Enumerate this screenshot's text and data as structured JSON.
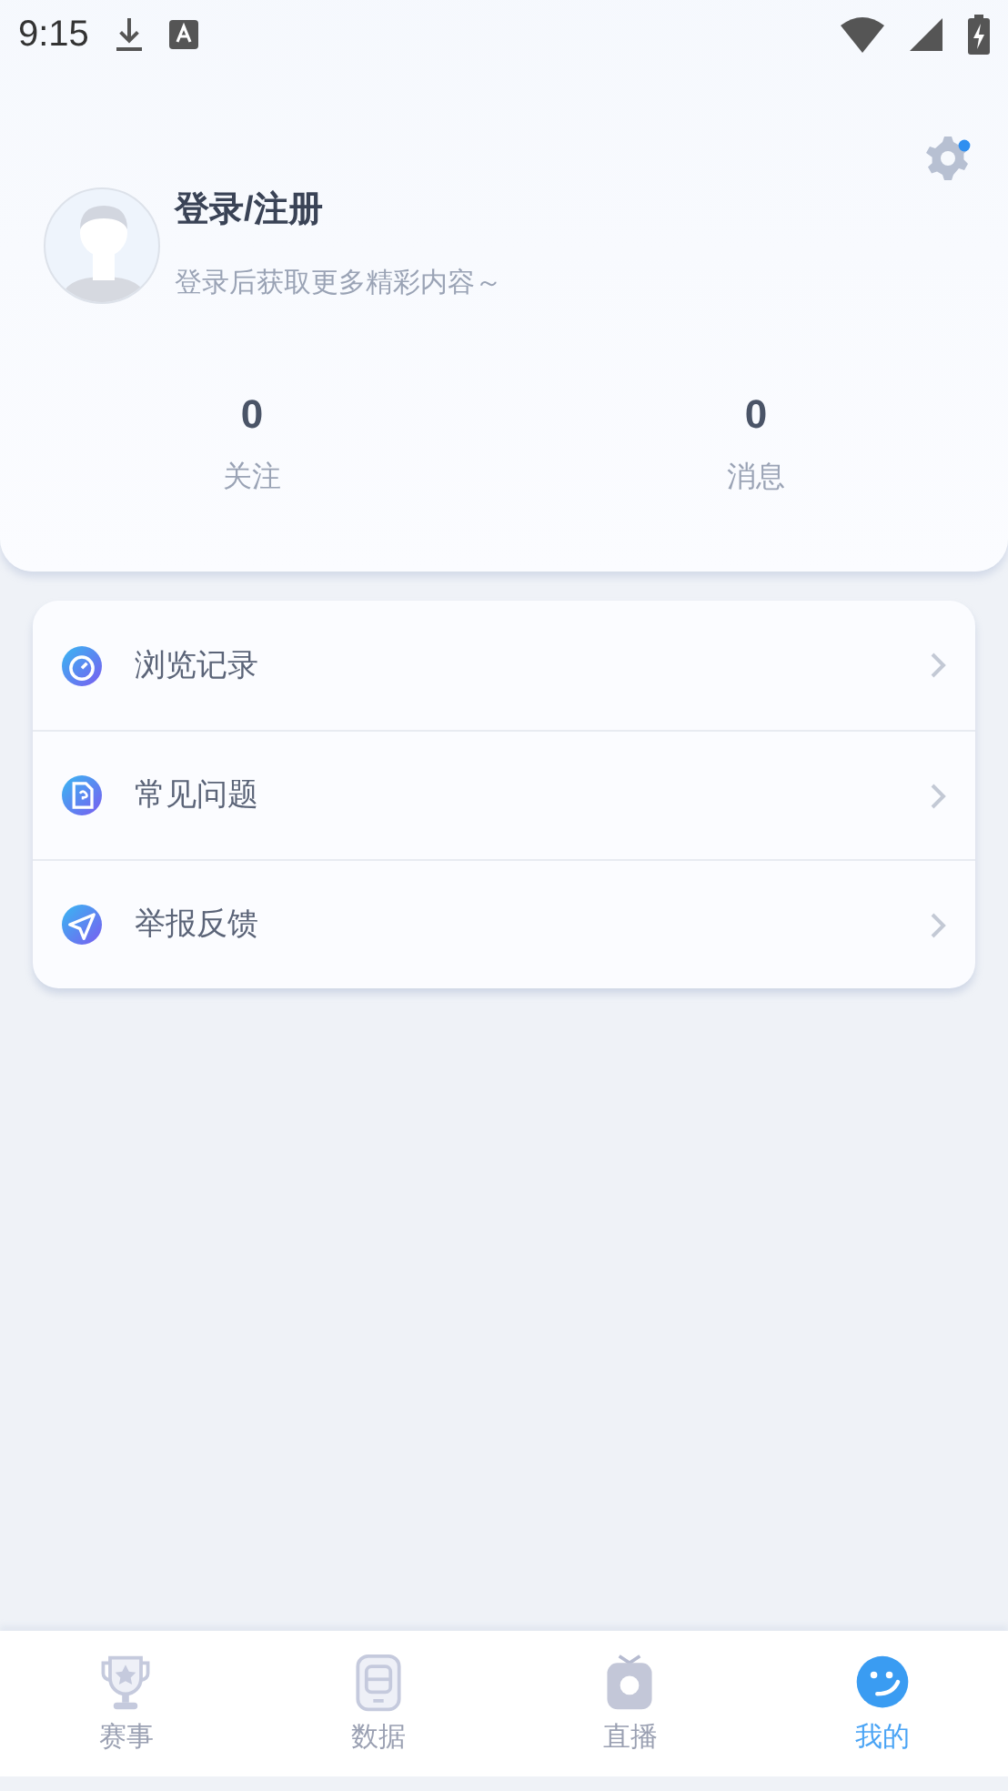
{
  "status_bar": {
    "time": "9:15"
  },
  "profile": {
    "title": "登录/注册",
    "subtitle": "登录后获取更多精彩内容～",
    "settings_badge": true
  },
  "stats": [
    {
      "value": "0",
      "label": "关注"
    },
    {
      "value": "0",
      "label": "消息"
    }
  ],
  "menu": [
    {
      "kind": "history",
      "label": "浏览记录"
    },
    {
      "kind": "faq",
      "label": "常见问题"
    },
    {
      "kind": "report",
      "label": "举报反馈"
    }
  ],
  "tabs": [
    {
      "kind": "trophy",
      "label": "赛事",
      "selected": false
    },
    {
      "kind": "data",
      "label": "数据",
      "selected": false
    },
    {
      "kind": "tv",
      "label": "直播",
      "selected": false
    },
    {
      "kind": "me",
      "label": "我的",
      "selected": true
    }
  ]
}
